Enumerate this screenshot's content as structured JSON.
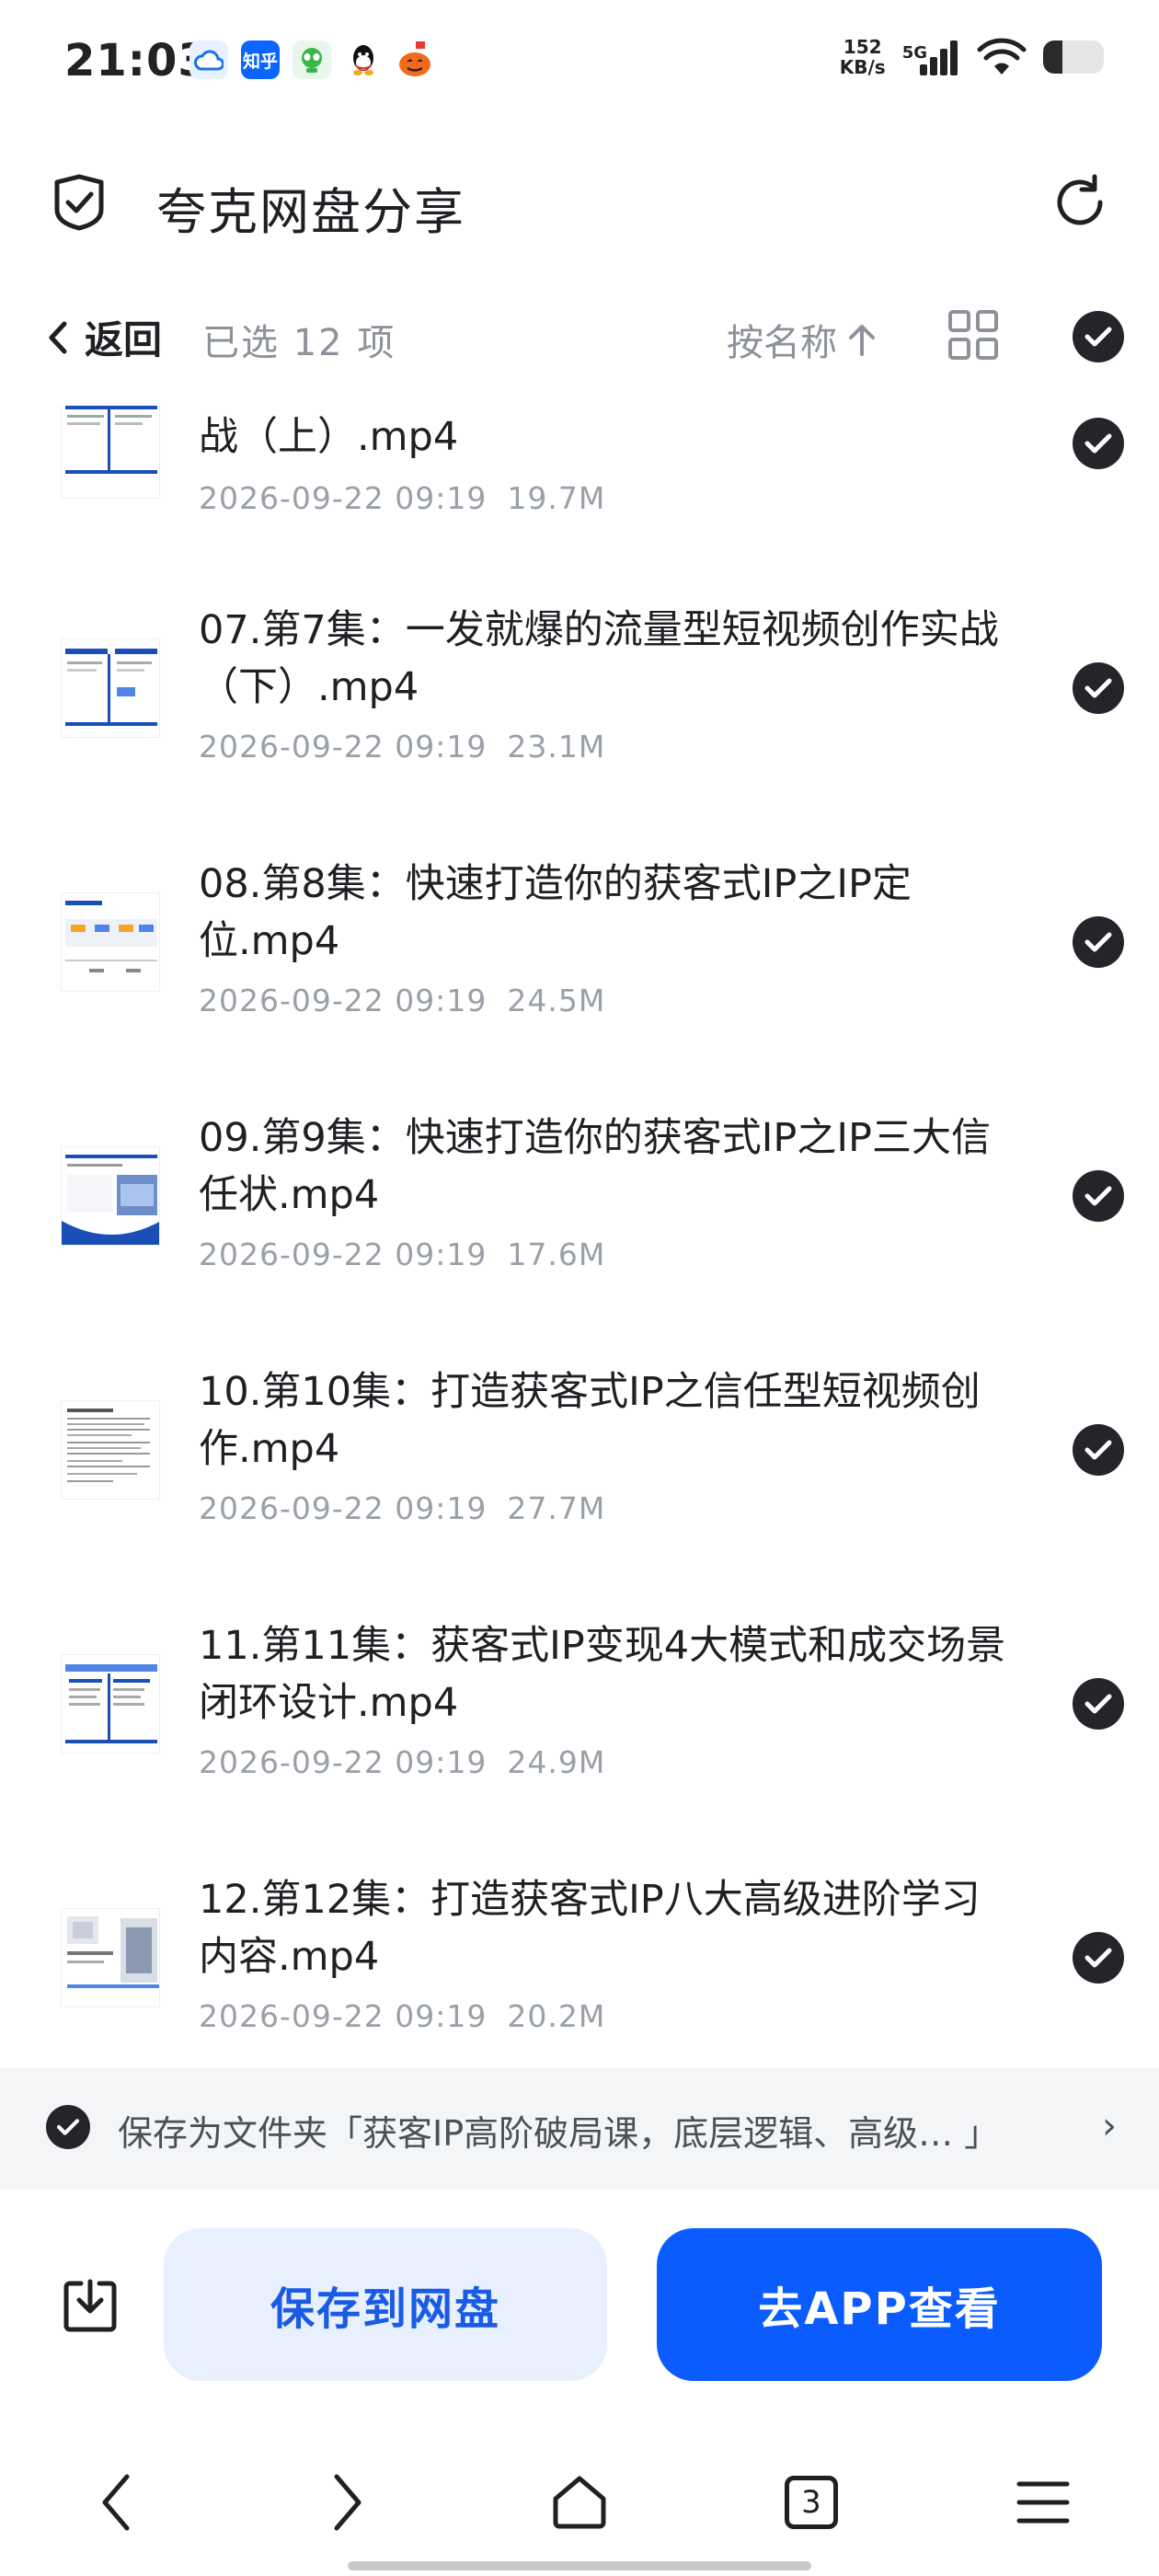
{
  "status_bar": {
    "time": "21:03",
    "app_icons": [
      "cloud-icon",
      "zhihu-icon",
      "alien-icon",
      "qq-icon",
      "pumpkin-icon"
    ],
    "zhihu_label": "知乎",
    "net_speed_value": "152",
    "net_speed_unit": "KB/s",
    "signal_label": "5G",
    "battery_level": 0.32
  },
  "header": {
    "title": "夸克网盘分享"
  },
  "toolbar": {
    "back_label": "返回",
    "selected_count": "已选 12 项",
    "sort_label": "按名称"
  },
  "files": [
    {
      "name": "战（上）.mp4",
      "date": "2026-09-22 09:19",
      "size": "19.7M"
    },
    {
      "name": "07.第7集：一发就爆的流量型短视频创作实战（下）.mp4",
      "date": "2026-09-22 09:19",
      "size": "23.1M"
    },
    {
      "name": "08.第8集：快速打造你的获客式IP之IP定位.mp4",
      "date": "2026-09-22 09:19",
      "size": "24.5M"
    },
    {
      "name": "09.第9集：快速打造你的获客式IP之IP三大信任状.mp4",
      "date": "2026-09-22 09:19",
      "size": "17.6M"
    },
    {
      "name": "10.第10集：打造获客式IP之信任型短视频创作.mp4",
      "date": "2026-09-22 09:19",
      "size": "27.7M"
    },
    {
      "name": "11.第11集：获客式IP变现4大模式和成交场景闭环设计.mp4",
      "date": "2026-09-22 09:19",
      "size": "24.9M"
    },
    {
      "name": "12.第12集：打造获客式IP八大高级进阶学习内容.mp4",
      "date": "2026-09-22 09:19",
      "size": "20.2M"
    }
  ],
  "save_banner": {
    "text": "保存为文件夹「获客IP高阶破局课，底层逻辑、高级… 」",
    "arrow": "›"
  },
  "actions": {
    "save_label": "保存到网盘",
    "app_label": "去APP查看"
  },
  "browser_nav": {
    "tab_count": "3"
  },
  "colors": {
    "primary": "#0b5cff",
    "primary_light": "#e8f0fd",
    "check": "#23252a"
  }
}
